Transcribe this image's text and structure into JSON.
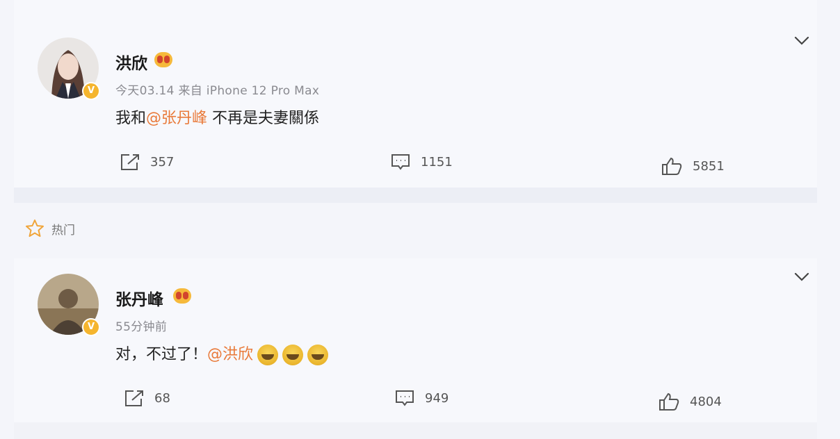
{
  "posts": [
    {
      "author": "洪欣",
      "verified_badge": "V",
      "meta": "今天03.14  来自 iPhone 12 Pro Max",
      "text_prefix": "我和",
      "mention": "@张丹峰",
      "text_suffix": " 不再是夫妻關係",
      "reposts": "357",
      "comments": "1151",
      "likes": "5851"
    },
    {
      "author": "张丹峰",
      "verified_badge": "V",
      "meta": "55分钟前",
      "text_prefix": "对，不过了！",
      "mention": "@洪欣",
      "emojis": [
        "laugh-cry-emoji",
        "laugh-cry-emoji",
        "laugh-cry-emoji"
      ],
      "reposts": "68",
      "comments": "949",
      "likes": "4804"
    }
  ],
  "section": {
    "hot_label": "热门"
  },
  "colors": {
    "mention": "#e97a3a",
    "badge": "#f5b52e",
    "background": "#f4f5fa"
  },
  "icons": [
    "chevron-down-icon",
    "repost-icon",
    "comment-icon",
    "like-icon",
    "star-icon"
  ]
}
